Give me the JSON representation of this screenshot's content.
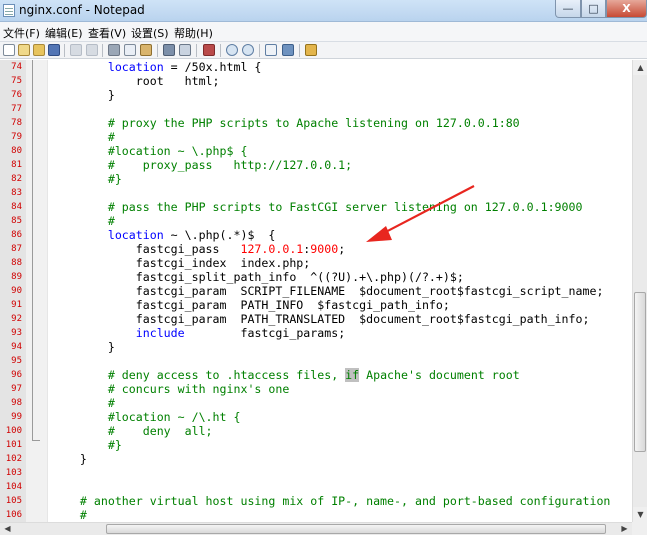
{
  "window": {
    "title": "nginx.conf - Notepad"
  },
  "window_buttons": {
    "minimize": "—",
    "maximize": "□",
    "close": "X"
  },
  "menubar": {
    "items": [
      "文件(F)",
      "编辑(E)",
      "查看(V)",
      "设置(S)",
      "帮助(H)"
    ]
  },
  "toolbar": {
    "icons": [
      "new-file-icon",
      "open-file-icon",
      "open-folder-icon",
      "save-icon",
      "undo-icon",
      "redo-icon",
      "cut-icon",
      "copy-icon",
      "paste-icon",
      "find-icon",
      "replace-icon",
      "goto-icon",
      "zoom-in-icon",
      "zoom-out-icon",
      "word-wrap-icon",
      "settings-icon",
      "edit-icon"
    ]
  },
  "editor": {
    "line_numbers": [
      "74",
      "75",
      "76",
      "77",
      "78",
      "79",
      "80",
      "81",
      "82",
      "83",
      "84",
      "85",
      "86",
      "87",
      "88",
      "89",
      "90",
      "91",
      "92",
      "93",
      "94",
      "95",
      "96",
      "97",
      "98",
      "99",
      "100",
      "101",
      "102",
      "103",
      "104",
      "105",
      "106"
    ],
    "lines": [
      [
        "        ",
        {
          "t": "location",
          "c": "kw"
        },
        " = /50x.html {"
      ],
      [
        "            root   html;"
      ],
      [
        "        }"
      ],
      [
        ""
      ],
      [
        {
          "t": "        # proxy the PHP scripts to Apache listening on 127.0.0.1:80",
          "c": "cm"
        }
      ],
      [
        {
          "t": "        #",
          "c": "cm"
        }
      ],
      [
        {
          "t": "        #location ~ \\.php$ {",
          "c": "cm"
        }
      ],
      [
        {
          "t": "        #    proxy_pass   http://127.0.0.1;",
          "c": "cm"
        }
      ],
      [
        {
          "t": "        #}",
          "c": "cm"
        }
      ],
      [
        ""
      ],
      [
        {
          "t": "        # pass the PHP scripts to FastCGI server listening on 127.0.0.1:9000",
          "c": "cm"
        }
      ],
      [
        {
          "t": "        #",
          "c": "cm"
        }
      ],
      [
        "        ",
        {
          "t": "location",
          "c": "kw"
        },
        " ~ \\.php(.*)$  {"
      ],
      [
        "            fastcgi_pass   ",
        {
          "t": "127.0.0.1",
          "c": "num"
        },
        ":",
        {
          "t": "9000",
          "c": "num"
        },
        ";"
      ],
      [
        "            fastcgi_index  index.php;"
      ],
      [
        "            fastcgi_split_path_info  ^((?U).+\\.php)(/?.+)$;"
      ],
      [
        "            fastcgi_param  SCRIPT_FILENAME  $document_root$fastcgi_script_name;"
      ],
      [
        "            fastcgi_param  PATH_INFO  $fastcgi_path_info;"
      ],
      [
        "            fastcgi_param  PATH_TRANSLATED  $document_root$fastcgi_path_info;"
      ],
      [
        "            ",
        {
          "t": "include",
          "c": "kw"
        },
        "        fastcgi_params;"
      ],
      [
        "        }"
      ],
      [
        ""
      ],
      [
        {
          "t": "        # deny access to .htaccess files, ",
          "c": "cm"
        },
        {
          "t": "if",
          "c": "cm hl"
        },
        {
          "t": " Apache's document root",
          "c": "cm"
        }
      ],
      [
        {
          "t": "        # concurs with nginx's one",
          "c": "cm"
        }
      ],
      [
        {
          "t": "        #",
          "c": "cm"
        }
      ],
      [
        {
          "t": "        #location ~ /\\.ht {",
          "c": "cm"
        }
      ],
      [
        {
          "t": "        #    deny  all;",
          "c": "cm"
        }
      ],
      [
        {
          "t": "        #}",
          "c": "cm"
        }
      ],
      [
        "    }"
      ],
      [
        ""
      ],
      [
        ""
      ],
      [
        {
          "t": "    # another virtual host using mix of IP-, name-, and port-based configuration",
          "c": "cm"
        }
      ],
      [
        {
          "t": "    #",
          "c": "cm"
        }
      ]
    ]
  },
  "colors": {
    "annotation_arrow": "#e8261f",
    "keyword": "#0000ff",
    "comment": "#008000",
    "number": "#ff0000"
  }
}
